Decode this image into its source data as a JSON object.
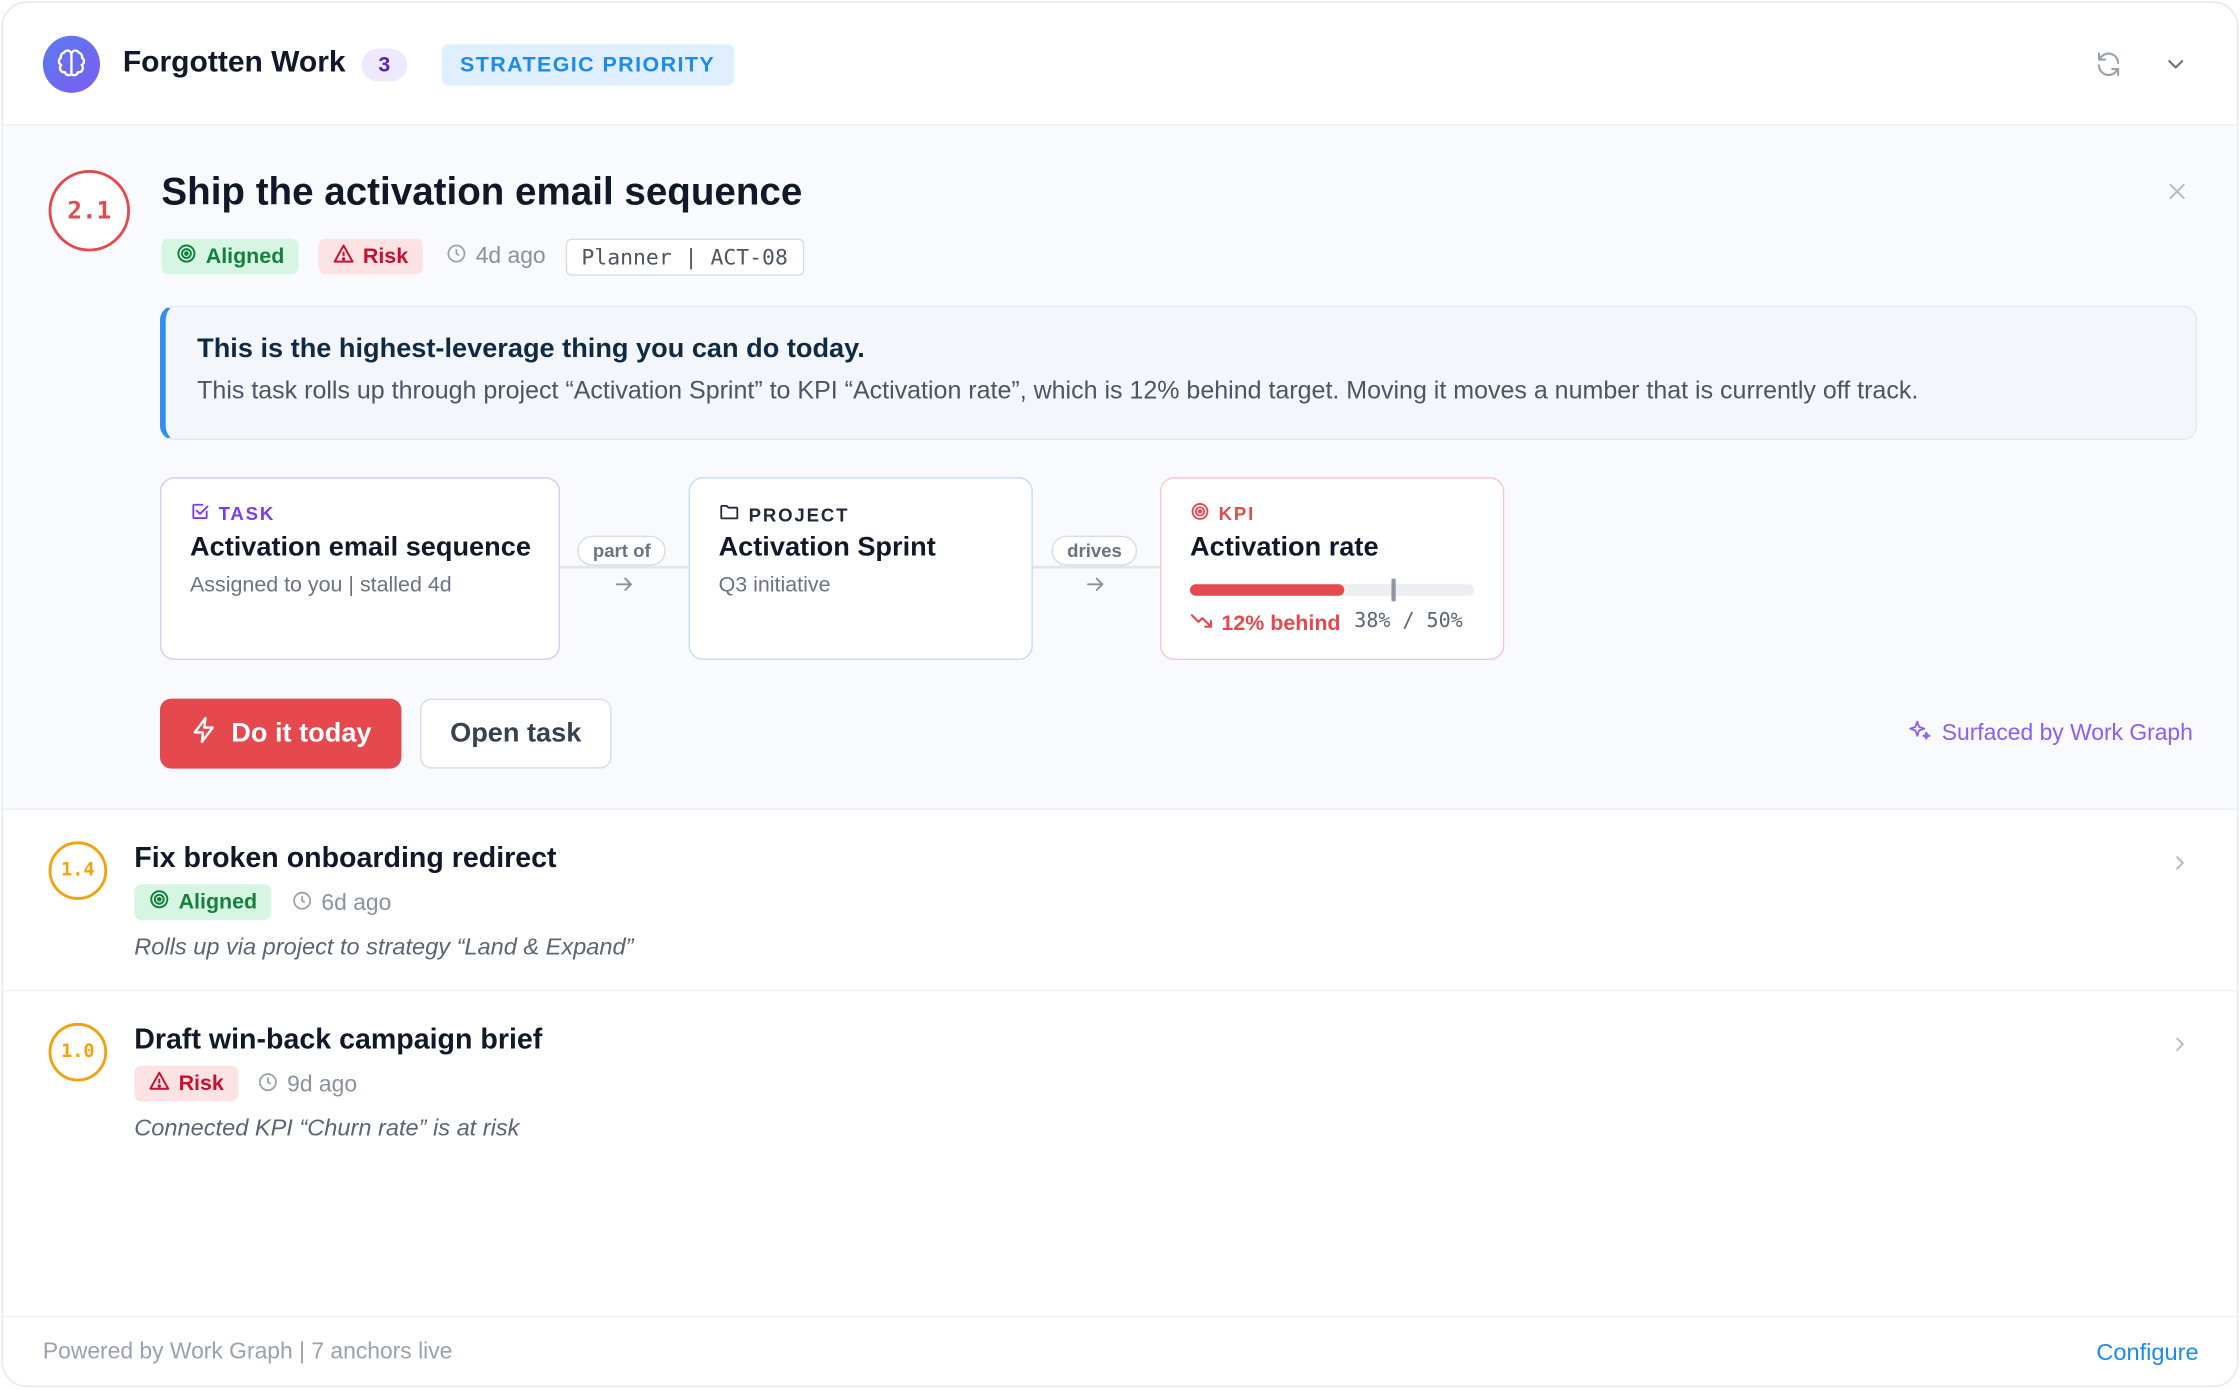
{
  "header": {
    "title": "Forgotten Work",
    "count": "3",
    "priority_label": "STRATEGIC PRIORITY",
    "icons": [
      "brain-icon",
      "refresh-icon",
      "chevron-down-icon"
    ]
  },
  "focus": {
    "score": "2.1",
    "title": "Ship the activation email sequence",
    "tags": {
      "aligned": "Aligned",
      "risk": "Risk"
    },
    "age": "4d ago",
    "ref": "Planner | ACT-08",
    "callout": {
      "heading": "This is the highest-leverage thing you can do today.",
      "body": "This task rolls up through project “Activation Sprint” to KPI “Activation rate”, which is 12% behind target. Moving it moves a number that is currently off track."
    },
    "chain": {
      "task": {
        "type": "TASK",
        "name": "Activation email sequence",
        "sub": "Assigned to you | stalled 4d"
      },
      "edge1": "part of",
      "project": {
        "type": "PROJECT",
        "name": "Activation Sprint",
        "sub": "Q3 initiative"
      },
      "edge2": "drives",
      "kpi": {
        "type": "KPI",
        "name": "Activation rate",
        "current_pct": 38,
        "target_pct": 50,
        "behind": "12% behind",
        "values": "38% / 50%"
      }
    },
    "actions": {
      "primary": "Do it today",
      "secondary": "Open task"
    },
    "surfaced": "Surfaced by Work Graph"
  },
  "rows": [
    {
      "score": "1.4",
      "title": "Fix broken onboarding redirect",
      "tag": "Aligned",
      "age": "6d ago",
      "note": "Rolls up via project to strategy “Land & Expand”"
    },
    {
      "score": "1.0",
      "title": "Draft win-back campaign brief",
      "tag": "Risk",
      "age": "9d ago",
      "note": "Connected KPI “Churn rate” is at risk"
    }
  ],
  "footer": {
    "text": "Powered by Work Graph | 7 anchors live",
    "configure": "Configure"
  },
  "colors": {
    "accent_red": "#e5484d",
    "accent_blue": "#1d8bea",
    "accent_purple": "#8b5cf6",
    "score_amber": "#f2a20c",
    "aligned_green": "#15803d"
  }
}
